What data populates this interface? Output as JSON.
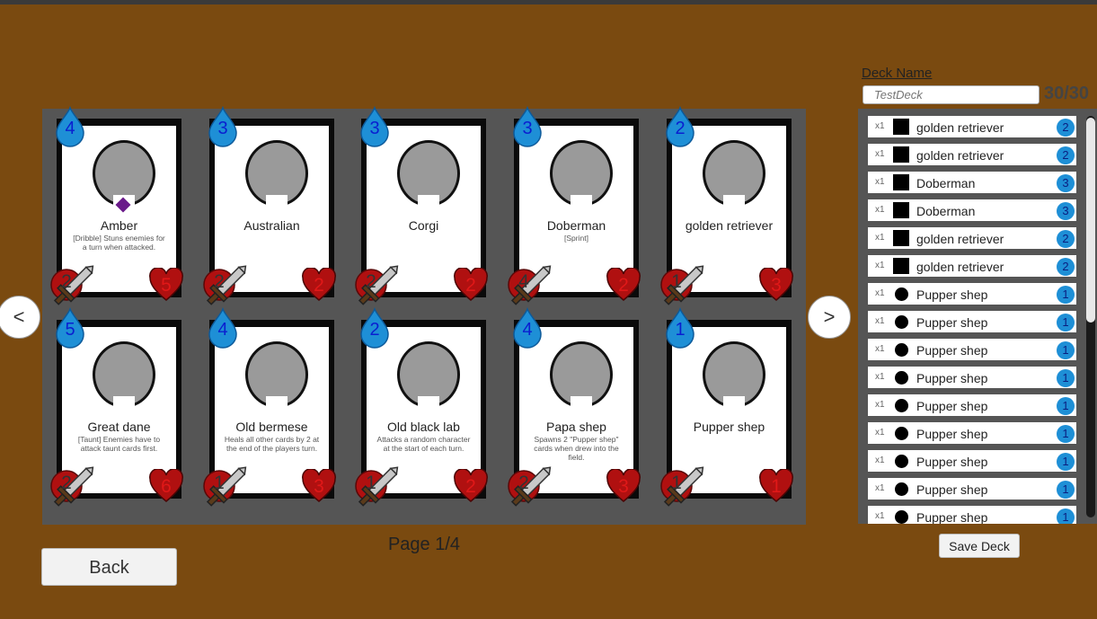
{
  "nav": {
    "prev_label": "<",
    "next_label": ">"
  },
  "page_label": "Page 1/4",
  "back_label": "Back",
  "deck": {
    "name_label": "Deck Name",
    "name_placeholder": "TestDeck",
    "count": "30/30",
    "save_label": "Save Deck",
    "entries": [
      {
        "qty": "x1",
        "icon": "square",
        "name": "golden retriever",
        "cost": "2"
      },
      {
        "qty": "x1",
        "icon": "square",
        "name": "golden retriever",
        "cost": "2"
      },
      {
        "qty": "x1",
        "icon": "square",
        "name": "Doberman",
        "cost": "3"
      },
      {
        "qty": "x1",
        "icon": "square",
        "name": "Doberman",
        "cost": "3"
      },
      {
        "qty": "x1",
        "icon": "square",
        "name": "golden retriever",
        "cost": "2"
      },
      {
        "qty": "x1",
        "icon": "square",
        "name": "golden retriever",
        "cost": "2"
      },
      {
        "qty": "x1",
        "icon": "circle",
        "name": "Pupper shep",
        "cost": "1"
      },
      {
        "qty": "x1",
        "icon": "circle",
        "name": "Pupper shep",
        "cost": "1"
      },
      {
        "qty": "x1",
        "icon": "circle",
        "name": "Pupper shep",
        "cost": "1"
      },
      {
        "qty": "x1",
        "icon": "circle",
        "name": "Pupper shep",
        "cost": "1"
      },
      {
        "qty": "x1",
        "icon": "circle",
        "name": "Pupper shep",
        "cost": "1"
      },
      {
        "qty": "x1",
        "icon": "circle",
        "name": "Pupper shep",
        "cost": "1"
      },
      {
        "qty": "x1",
        "icon": "circle",
        "name": "Pupper shep",
        "cost": "1"
      },
      {
        "qty": "x1",
        "icon": "circle",
        "name": "Pupper shep",
        "cost": "1"
      },
      {
        "qty": "x1",
        "icon": "circle",
        "name": "Pupper shep",
        "cost": "1"
      }
    ]
  },
  "cards": [
    {
      "name": "Amber",
      "desc": "[Dribble] Stuns enemies for a turn when attacked.",
      "cost": "4",
      "attack": "2",
      "health": "5",
      "gem": true
    },
    {
      "name": "Australian",
      "desc": "",
      "cost": "3",
      "attack": "2",
      "health": "2",
      "gem": false
    },
    {
      "name": "Corgi",
      "desc": "",
      "cost": "3",
      "attack": "2",
      "health": "2",
      "gem": false
    },
    {
      "name": "Doberman",
      "desc": "[Sprint]",
      "cost": "3",
      "attack": "4",
      "health": "2",
      "gem": false
    },
    {
      "name": "golden retriever",
      "desc": "",
      "cost": "2",
      "attack": "1",
      "health": "3",
      "gem": false
    },
    {
      "name": "Great dane",
      "desc": "[Taunt] Enemies have to attack taunt cards first.",
      "cost": "5",
      "attack": "2",
      "health": "6",
      "gem": false
    },
    {
      "name": "Old bermese",
      "desc": "Heals all other cards by 2 at the end of the players turn.",
      "cost": "4",
      "attack": "1",
      "health": "3",
      "gem": false
    },
    {
      "name": "Old black lab",
      "desc": "Attacks a random character at the start of each turn.",
      "cost": "2",
      "attack": "1",
      "health": "2",
      "gem": false
    },
    {
      "name": "Papa shep",
      "desc": "Spawns 2 \"Pupper shep\" cards when drew into the field.",
      "cost": "4",
      "attack": "2",
      "health": "3",
      "gem": false
    },
    {
      "name": "Pupper shep",
      "desc": "",
      "cost": "1",
      "attack": "1",
      "health": "1",
      "gem": false
    }
  ],
  "colors": {
    "background": "#7a4a10",
    "panel": "#555555",
    "mana": "#1e8fd6",
    "health": "#b01010"
  }
}
